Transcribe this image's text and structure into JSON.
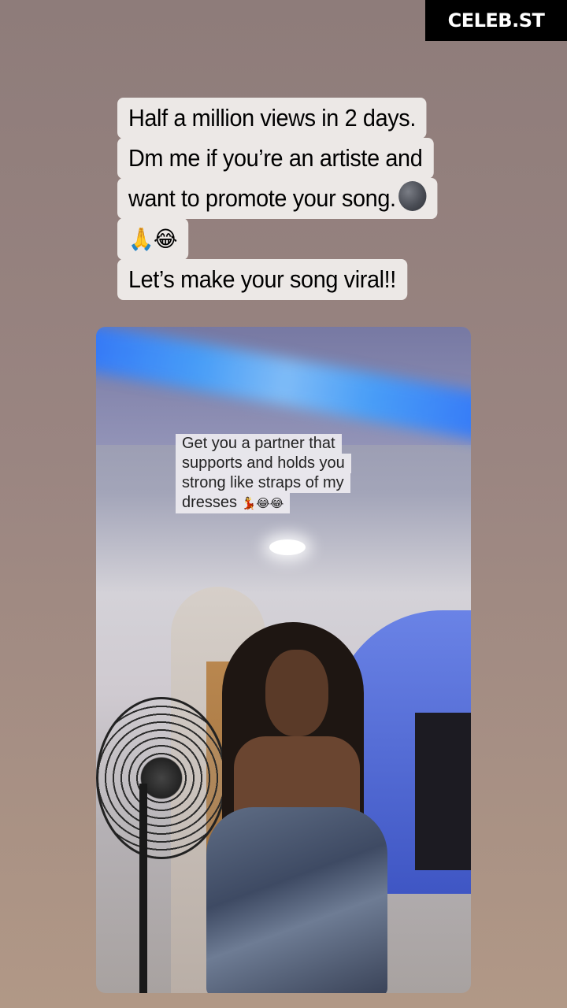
{
  "watermark": "CELEB.ST",
  "caption": {
    "line1": "Half a million views in 2 days.",
    "line2": "Dm me if you’re an artiste and",
    "line3": "want to promote your song.",
    "line3_emoji": "🌚",
    "line4": "🙏😂",
    "line5": "Let’s make your song viral!!"
  },
  "video_overlay": {
    "line1": "Get you a partner that",
    "line2": "supports and holds you",
    "line3": "strong like straps of my",
    "line4": "dresses",
    "line4_emoji": "💃😂😂"
  }
}
